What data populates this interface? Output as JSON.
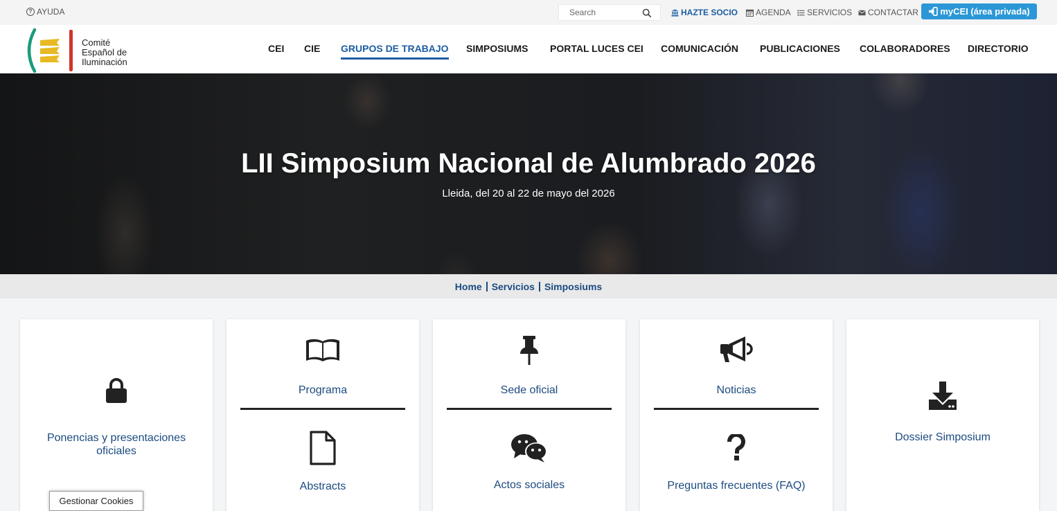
{
  "topbar": {
    "ayuda": "AYUDA",
    "search_placeholder": "Search",
    "hazte_socio": "HAZTE SOCIO",
    "agenda": "AGENDA",
    "servicios": "SERVICIOS",
    "contactar": "CONTACTAR",
    "mycei": "myCEI (área privada)"
  },
  "logo": {
    "line1": "Comité",
    "line2": "Español de",
    "line3": "Iluminación"
  },
  "nav": [
    {
      "label": "CEI"
    },
    {
      "label": "CIE"
    },
    {
      "label": "GRUPOS DE TRABAJO",
      "active": true
    },
    {
      "label": "SIMPOSIUMS"
    },
    {
      "label": "PORTAL LUCES CEI"
    },
    {
      "label": "COMUNICACIÓN"
    },
    {
      "label": "PUBLICACIONES"
    },
    {
      "label": "COLABORADORES"
    },
    {
      "label": "DIRECTORIO"
    }
  ],
  "hero": {
    "title": "LII Simposium Nacional de Alumbrado 2026",
    "subtitle": "Lleida, del 20 al 22 de mayo del 2026"
  },
  "breadcrumb": [
    "Home",
    "Servicios",
    "Simposiums"
  ],
  "cards": {
    "ponencias": {
      "label": "Ponencias y presentaciones oficiales",
      "icon": "lock-icon"
    },
    "programa": {
      "label": "Programa",
      "icon": "book-open-icon"
    },
    "abstracts": {
      "label": "Abstracts",
      "icon": "file-icon"
    },
    "sede": {
      "label": "Sede oficial",
      "icon": "thumbtack-icon"
    },
    "actos": {
      "label": "Actos sociales",
      "icon": "chat-bubbles-icon"
    },
    "noticias": {
      "label": "Noticias",
      "icon": "megaphone-icon"
    },
    "faq": {
      "label": "Preguntas frecuentes (FAQ)",
      "icon": "question-icon"
    },
    "dossier": {
      "label": "Dossier Simposium",
      "icon": "download-icon"
    }
  },
  "cookies": "Gestionar Cookies",
  "colors": {
    "accent": "#1b5da3",
    "link": "#1b4b80",
    "mycei_button": "#2b97d6",
    "logo_green": "#1a9c7c",
    "logo_yellow": "#e8b923",
    "logo_red": "#d3332a"
  }
}
